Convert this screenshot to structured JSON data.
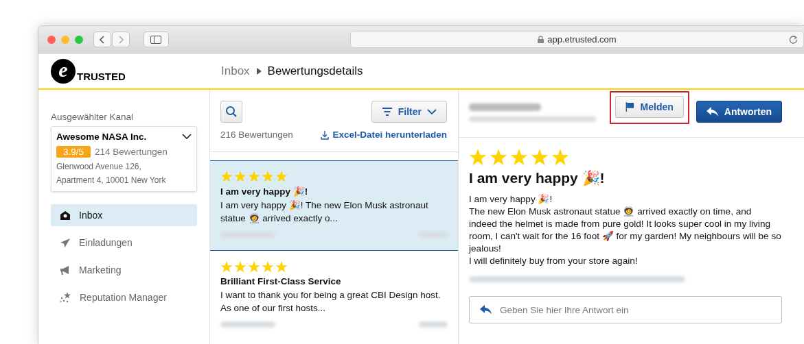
{
  "browser": {
    "url": "app.etrusted.com"
  },
  "logo": {
    "mark": "e",
    "text": "TRUSTED"
  },
  "breadcrumb": [
    {
      "label": "Inbox"
    },
    {
      "label": "Bewertungsdetails"
    }
  ],
  "sidebar": {
    "channel_label": "Ausgewählter Kanal",
    "channel": {
      "name": "Awesome NASA Inc.",
      "rating": "3.9/5",
      "count": "214 Bewertungen",
      "address": [
        "Glenwood Avenue 126,",
        "Apartment 4, 10001 New York"
      ]
    },
    "items": [
      {
        "label": "Inbox",
        "kind": "inbox",
        "selected": true
      },
      {
        "label": "Einladungen",
        "kind": "send",
        "selected": false
      },
      {
        "label": "Marketing",
        "kind": "megaphone",
        "selected": false
      },
      {
        "label": "Reputation Manager",
        "kind": "stars",
        "selected": false
      }
    ]
  },
  "list": {
    "count": "216 Bewertungen",
    "filter": "Filter",
    "download": "Excel-Datei herunterladen",
    "reviews": [
      {
        "stars": 5,
        "title": "I am very happy 🎉!",
        "excerpt": "I am very happy 🎉! The new Elon Musk astronaut statue 🧑‍🚀 arrived exactly o...",
        "selected": true
      },
      {
        "stars": 5,
        "title": "Brilliant First-Class Service",
        "excerpt": "I want to thank you for being a great CBI Design host. As one of our first hosts...",
        "selected": false
      }
    ]
  },
  "detail": {
    "report_button": "Melden",
    "reply_button": "Antworten",
    "stars": 5,
    "title": "I am very happy 🎉!",
    "body": [
      "I am very happy 🎉!",
      "The new Elon Musk astronaut statue 🧑‍🚀 arrived exactly on time, and indeed the helmet is made from pure gold! It looks super cool in my living room, I can't wait for the 16 foot 🚀 for my garden! My neighbours will be so jealous!",
      "I will definitely buy from your store again!"
    ],
    "reply_placeholder": "Geben Sie hier Ihre Antwort ein"
  }
}
